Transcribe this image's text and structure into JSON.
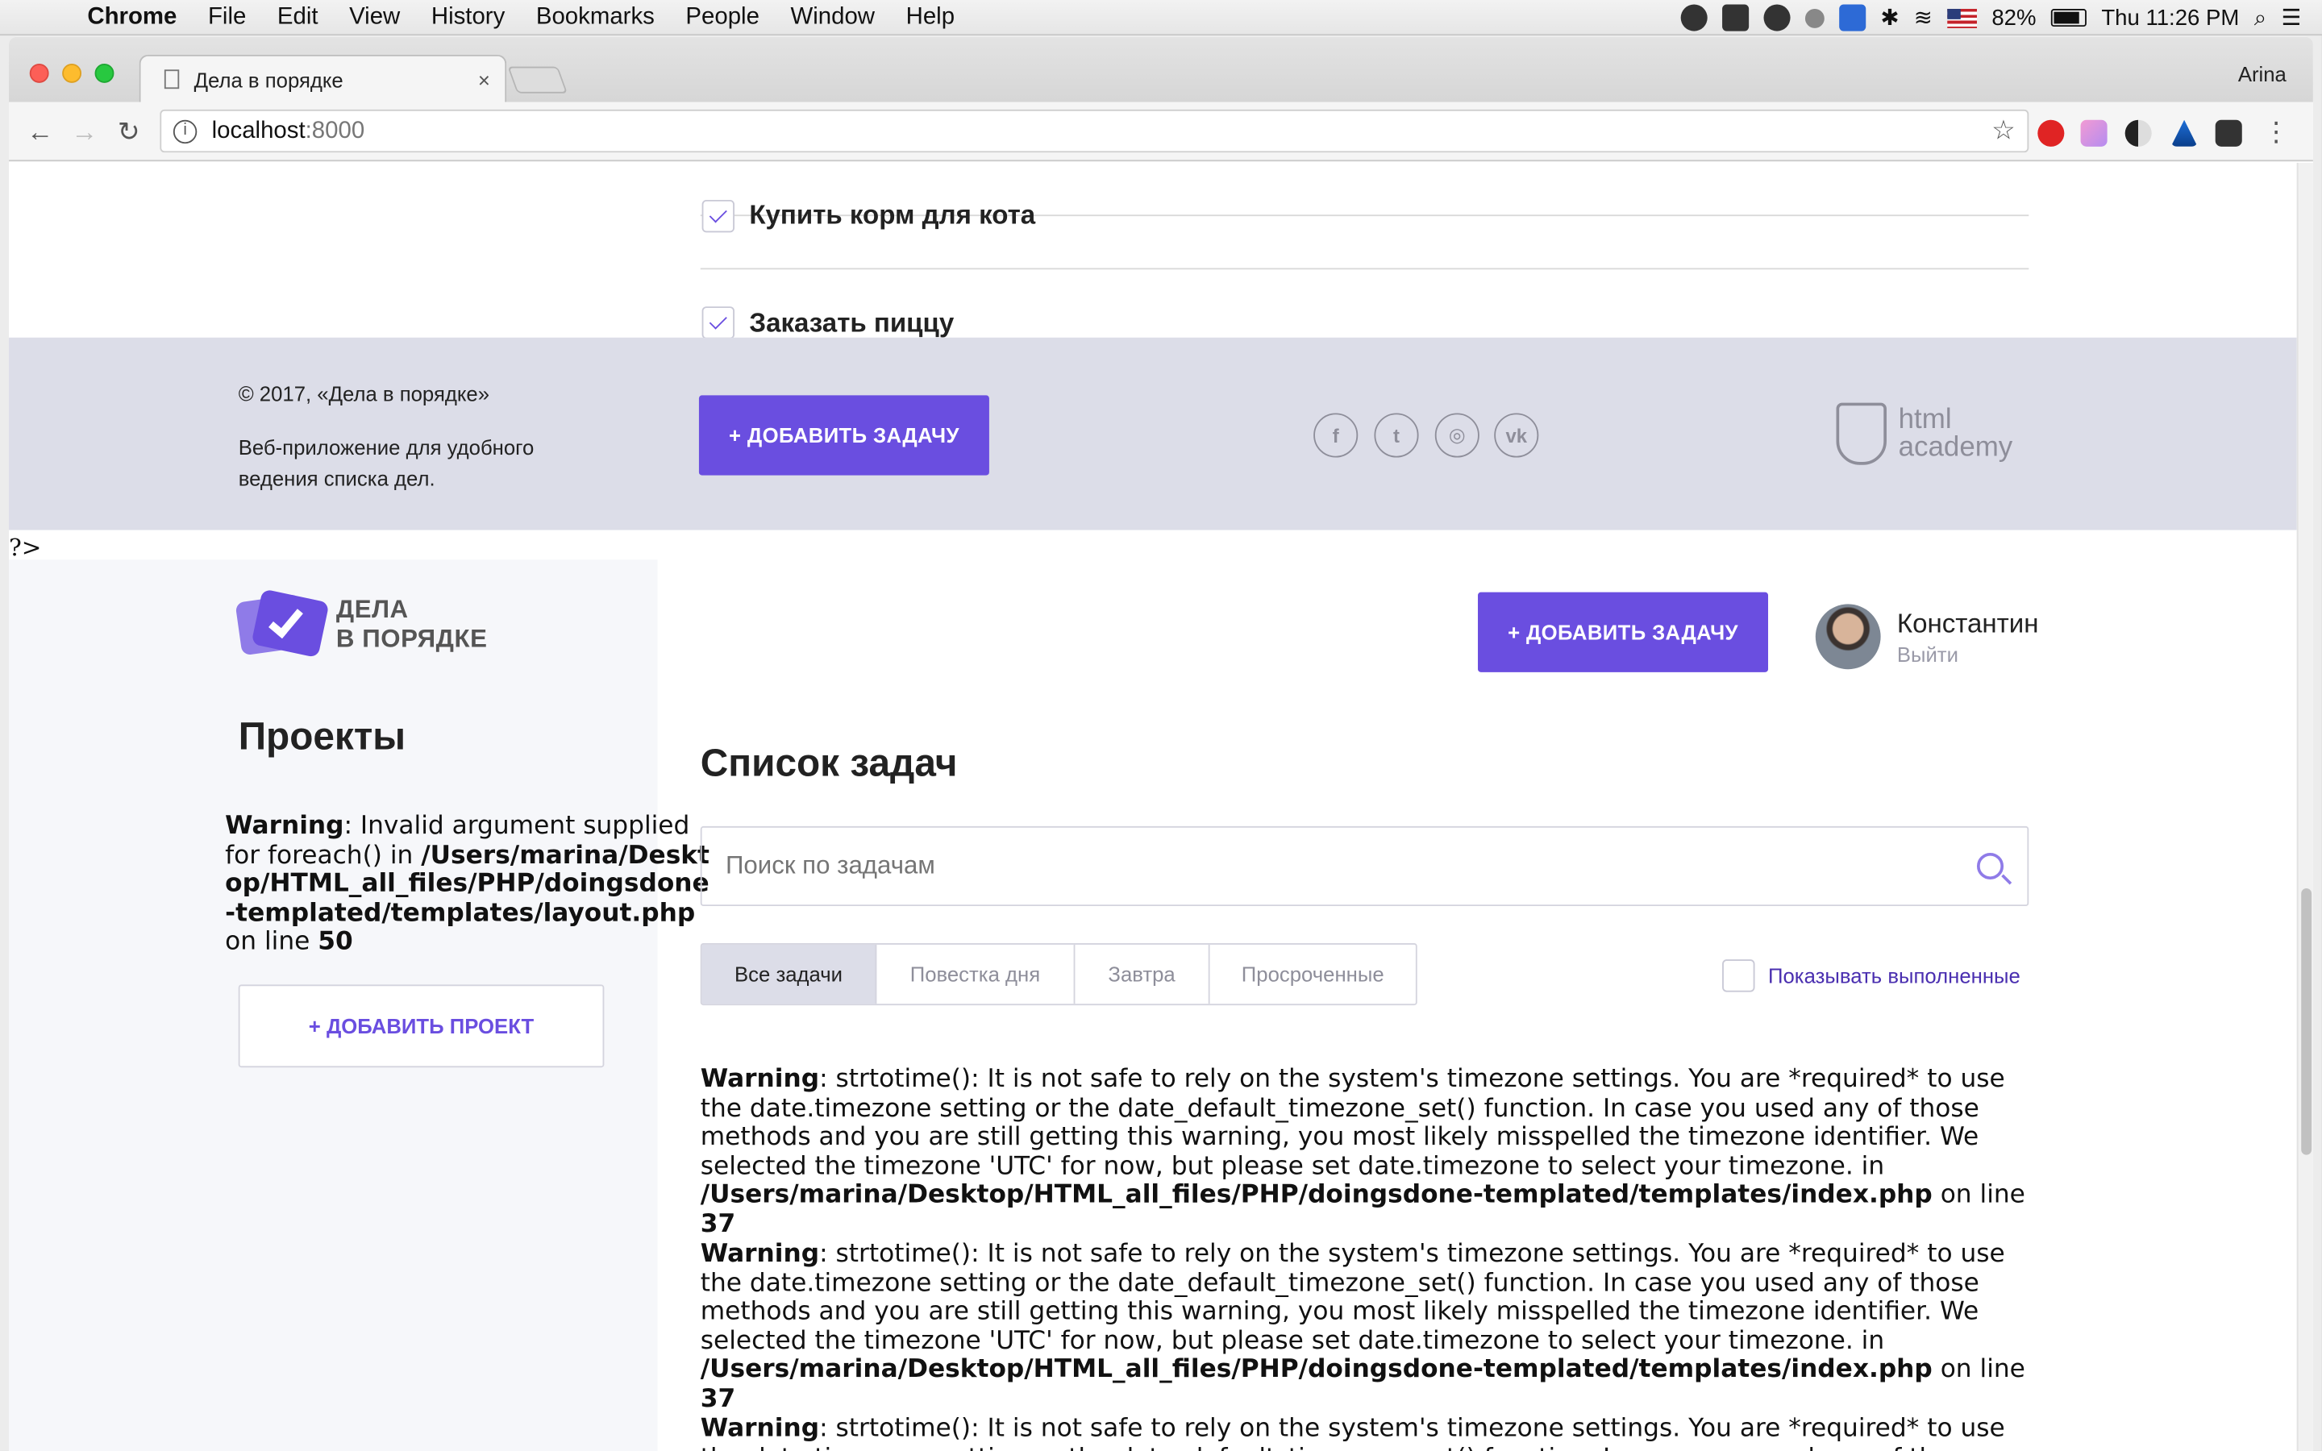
{
  "menubar": {
    "app": "Chrome",
    "items": [
      "File",
      "Edit",
      "View",
      "History",
      "Bookmarks",
      "People",
      "Window",
      "Help"
    ],
    "battery": "82%",
    "clock": "Thu 11:26 PM"
  },
  "browser": {
    "tab_title": "Дела в порядке",
    "tab_close": "×",
    "profile": "Arina",
    "url_host": "localhost",
    "url_port": ":8000",
    "star": "☆"
  },
  "tasks_upper": [
    {
      "label": "Купить корм для кота",
      "checked": true
    },
    {
      "label": "Заказать пиццу",
      "checked": true
    }
  ],
  "footer": {
    "copyright": "© 2017, «Дела в порядке»",
    "description": "Веб-приложение для удобного ведения списка дел.",
    "add_task": "+ ДОБАВИТЬ ЗАДАЧУ",
    "social": [
      "f",
      "t",
      "◎",
      "vk"
    ],
    "academy_line1": "html",
    "academy_line2": "academy"
  },
  "php_tag": "?>",
  "sidebar": {
    "logo_line1": "ДЕЛА",
    "logo_line2": "В ПОРЯДКЕ",
    "title": "Проекты",
    "warning": {
      "label": "Warning",
      "text": ": Invalid argument supplied for foreach() in ",
      "path": "/Users/marina/Desktop/HTML_all_files/PHP/doingsdone-templated/templates/layout.php",
      "on_line": " on line ",
      "line": "50"
    },
    "add_project": "+ ДОБАВИТЬ ПРОЕКТ"
  },
  "header": {
    "add_task": "+ ДОБАВИТЬ ЗАДАЧУ",
    "user_name": "Константин",
    "logout": "Выйти"
  },
  "main": {
    "title": "Список задач",
    "search_placeholder": "Поиск по задачам",
    "filters": [
      "Все задачи",
      "Повестка дня",
      "Завтра",
      "Просроченные"
    ],
    "show_done": "Показывать выполненные",
    "warnings": [
      {
        "label": "Warning",
        "text": ": strtotime(): It is not safe to rely on the system's timezone settings. You are *required* to use the date.timezone setting or the date_default_timezone_set() function. In case you used any of those methods and you are still getting this warning, you most likely misspelled the timezone identifier. We selected the timezone 'UTC' for now, but please set date.timezone to select your timezone. in ",
        "path": "/Users/marina/Desktop/HTML_all_files/PHP/doingsdone-templated/templates/index.php",
        "on_line": " on line ",
        "line": "37"
      },
      {
        "label": "Warning",
        "text": ": strtotime(): It is not safe to rely on the system's timezone settings. You are *required* to use the date.timezone setting or the date_default_timezone_set() function. In case you used any of those methods and you are still getting this warning, you most likely misspelled the timezone identifier. We selected the timezone 'UTC' for now, but please set date.timezone to select your timezone. in ",
        "path": "/Users/marina/Desktop/HTML_all_files/PHP/doingsdone-templated/templates/index.php",
        "on_line": " on line ",
        "line": "37"
      },
      {
        "label": "Warning",
        "text": ": strtotime(): It is not safe to rely on the system's timezone settings. You are *required* to use the date.timezone setting or the date_default_timezone_set() function. In case you used any of those methods and",
        "path": "",
        "on_line": "",
        "line": ""
      }
    ]
  },
  "colors": {
    "accent": "#6a4ee0",
    "footer_bg": "#dcdde8",
    "sidebar_bg": "#f6f7fa"
  }
}
